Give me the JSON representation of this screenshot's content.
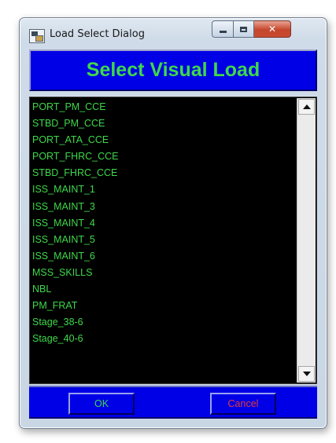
{
  "window": {
    "title": "Load Select Dialog",
    "caption_buttons": {
      "minimize": "minimize",
      "maximize": "maximize",
      "close": "✕"
    }
  },
  "header": {
    "title": "Select Visual Load"
  },
  "list": {
    "items": [
      "PORT_PM_CCE",
      "STBD_PM_CCE",
      "PORT_ATA_CCE",
      "PORT_FHRC_CCE",
      "STBD_FHRC_CCE",
      "ISS_MAINT_1",
      "ISS_MAINT_3",
      "ISS_MAINT_4",
      "ISS_MAINT_5",
      "ISS_MAINT_6",
      "MSS_SKILLS",
      "NBL",
      "PM_FRAT",
      "Stage_38-6",
      "Stage_40-6"
    ]
  },
  "footer": {
    "ok_label": "OK",
    "cancel_label": "Cancel"
  },
  "colors": {
    "panel_blue": "#0000e6",
    "text_green": "#3fd84a",
    "cancel_red": "#e63b3b",
    "list_background": "#000000"
  }
}
